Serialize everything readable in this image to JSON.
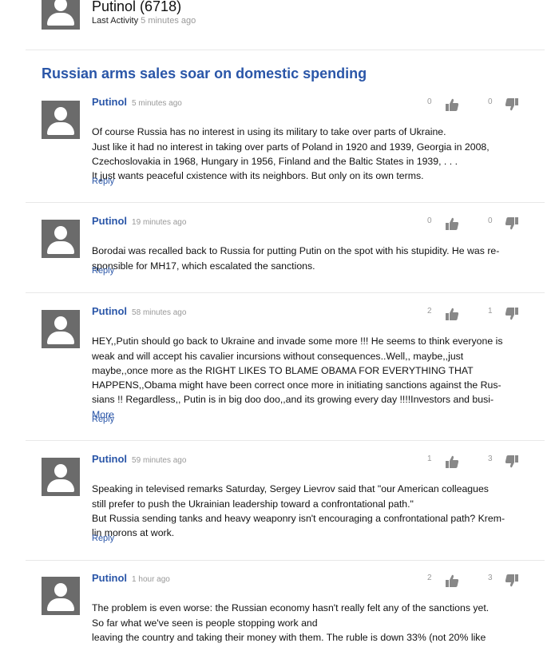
{
  "profile": {
    "name": "Putinol (6718)",
    "activity_label": "Last Activity",
    "activity_time": "5 minutes ago"
  },
  "article": {
    "title": "Russian arms sales soar on domestic spending"
  },
  "icons": {
    "avatar": "user-silhouette-icon",
    "like": "thumbs-up-icon",
    "dislike": "thumbs-down-icon"
  },
  "colors": {
    "link": "#2a56a8",
    "avatar_bg": "#6b6b6b",
    "muted": "#999999"
  },
  "comments": [
    {
      "author": "Putinol",
      "time": "5 minutes ago",
      "likes": "0",
      "dislikes": "0",
      "text": "Of course Russia has no interest in using its military to take over parts of Ukraine.\nJust like it had no interest in taking over parts of Poland in 1920 and 1939, Georgia in 2008,\nCzechoslovakia in 1968, Hungary in 1956, Finland and the Baltic States in 1939, . . .\nIt just wants peaceful cxistence with its neighbors. But only on its own terms.",
      "more": "",
      "reply": "Reply"
    },
    {
      "author": "Putinol",
      "time": "19 minutes ago",
      "likes": "0",
      "dislikes": "0",
      "text": "Borodai was recalled back to Russia for putting Putin on the spot with his stupidity. He was re-\nsponsible for MH17, which escalated the sanctions.",
      "more": "",
      "reply": "Reply"
    },
    {
      "author": "Putinol",
      "time": "58 minutes ago",
      "likes": "2",
      "dislikes": "1",
      "text": "HEY,,Putin should go back to Ukraine and invade some more !!! He seems to think everyone is\nweak and will accept his cavalier incursions without consequences..Well,, maybe,,just\nmaybe,,once more as the RIGHT LIKES TO BLAME OBAMA FOR EVERYTHING THAT\nHAPPENS,,Obama might have been correct once more in initiating sanctions against the Rus-\nsians !! Regardless,, Putin is in big doo doo,,and its growing every day !!!!Investors and busi-",
      "more": "More",
      "reply": "Reply"
    },
    {
      "author": "Putinol",
      "time": "59 minutes ago",
      "likes": "1",
      "dislikes": "3",
      "text": "Speaking in televised remarks Saturday, Sergey Lievrov said that \"our American colleagues\nstill prefer to push the Ukrainian leadership toward a confrontational path.\"\nBut Russia sending tanks and heavy weaponry isn't encouraging a confrontational path? Krem-\nlin morons at work.",
      "more": "",
      "reply": "Reply"
    },
    {
      "author": "Putinol",
      "time": "1 hour ago",
      "likes": "2",
      "dislikes": "3",
      "text": "The problem is even worse: the Russian economy hasn't really felt any of the sanctions yet.\nSo far what we've seen is people stopping work and\nleaving the country and taking their money with them. The ruble is down 33% (not 20% like",
      "more": "",
      "reply": ""
    }
  ]
}
